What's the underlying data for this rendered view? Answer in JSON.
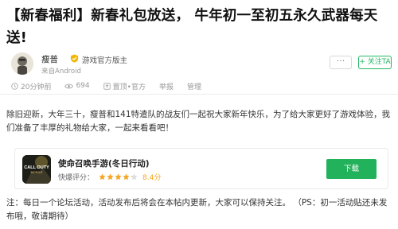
{
  "post": {
    "title": "【新春福利】新春礼包放送， 牛年初一至初五永久武器每天送!"
  },
  "author": {
    "name": "瘦普",
    "role": "游戏官方版主",
    "source": "来自Android",
    "follow_label": "+ 关注TA",
    "more_label": "···"
  },
  "meta": {
    "time": "20分钟前",
    "views": "694",
    "pin": "置顶•官方",
    "report": "举报",
    "manage": "管理"
  },
  "content": {
    "paragraph": "除旧迎新，大年三十，瘦普和141特遣队的战友们一起祝大家新年快乐，为了给大家更好了游戏体验，我们准备了丰厚的礼物给大家，一起来看看吧！",
    "note": "注：每日一个论坛活动，活动发布后将会在本帖内更新，大家可以保持关注。 （PS：初一活动贴还未发布哦，敬请期待）"
  },
  "game_card": {
    "name": "使命召唤手游(冬日行动)",
    "rating_label": "快爆评分：",
    "rating": "8.4分",
    "stars": 4.2,
    "download_label": "下载",
    "icon_text": "CALL·DUTY",
    "icon_sub": "MOBILE"
  },
  "colors": {
    "accent_green": "#23b25c",
    "star_gold": "#f5a623"
  }
}
